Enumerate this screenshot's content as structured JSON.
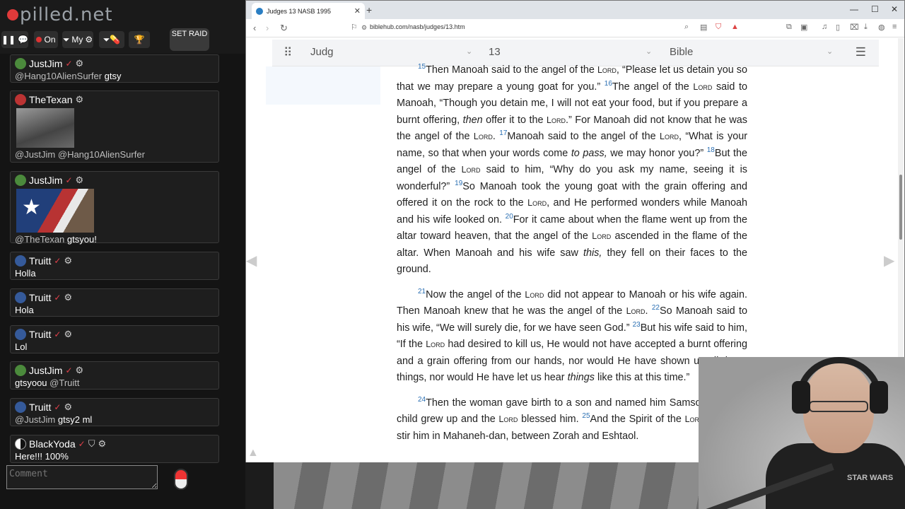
{
  "chat": {
    "logo": "pilled.net",
    "toolbar": {
      "on_label": "On",
      "my_label": "My",
      "raid_label": "SET RAID"
    },
    "messages": [
      {
        "user": "JustJim",
        "text": "",
        "mention": "@Hang10AlienSurfer",
        "tail": "gtsy",
        "avatar": "green"
      },
      {
        "user": "TheTexan",
        "text": "",
        "mention": "@JustJim @Hang10AlienSurfer",
        "tail": "",
        "avatar": "red",
        "image": "gif"
      },
      {
        "user": "JustJim",
        "text": "",
        "mention": "@TheTexan",
        "tail": "gtsyou!",
        "avatar": "green",
        "image": "texas"
      },
      {
        "user": "Truitt",
        "text": "Holla",
        "avatar": "blue"
      },
      {
        "user": "Truitt",
        "text": "Hola",
        "avatar": "blue"
      },
      {
        "user": "Truitt",
        "text": "Lol",
        "avatar": "blue"
      },
      {
        "user": "JustJim",
        "text": "gtsyoou",
        "mention": "@Truitt",
        "tail": "",
        "avatar": "green"
      },
      {
        "user": "Truitt",
        "text": "",
        "mention": "@JustJim",
        "tail": "gtsy2 ml",
        "avatar": "blue"
      },
      {
        "user": "BlackYoda",
        "text": "Here!!! 100%",
        "avatar": "yin"
      }
    ],
    "comment_placeholder": "Comment"
  },
  "browser": {
    "tab_title": "Judges 13 NASB 1995",
    "url": "biblehub.com/nasb/judges/13.htm",
    "selectors": {
      "book": "Judg",
      "chapter": "13",
      "version": "Bible"
    }
  },
  "scripture": {
    "paragraphs": [
      [
        {
          "t": "v",
          "s": "15"
        },
        {
          "t": "n",
          "s": "Then Manoah said to the angel of the "
        },
        {
          "t": "sc",
          "s": "Lord"
        },
        {
          "t": "n",
          "s": ", “Please let us detain you so that we may prepare a young goat for you.” "
        },
        {
          "t": "v",
          "s": "16"
        },
        {
          "t": "n",
          "s": "The angel of the "
        },
        {
          "t": "sc",
          "s": "Lord"
        },
        {
          "t": "n",
          "s": " said to Manoah, “Though you detain me, I will not eat your food, but if you prepare a burnt offering, "
        },
        {
          "t": "i",
          "s": "then"
        },
        {
          "t": "n",
          "s": " offer it to the "
        },
        {
          "t": "sc",
          "s": "Lord"
        },
        {
          "t": "n",
          "s": ".” For Manoah did not know that he was the angel of the "
        },
        {
          "t": "sc",
          "s": "Lord"
        },
        {
          "t": "n",
          "s": ". "
        },
        {
          "t": "v",
          "s": "17"
        },
        {
          "t": "n",
          "s": "Manoah said to the angel of the "
        },
        {
          "t": "sc",
          "s": "Lord"
        },
        {
          "t": "n",
          "s": ", “What is your name, so that when your words come "
        },
        {
          "t": "i",
          "s": "to pass,"
        },
        {
          "t": "n",
          "s": " we may honor you?” "
        },
        {
          "t": "v",
          "s": "18"
        },
        {
          "t": "n",
          "s": "But the angel of the "
        },
        {
          "t": "sc",
          "s": "Lord"
        },
        {
          "t": "n",
          "s": " said to him, “Why do you ask my name, seeing it is wonderful?” "
        },
        {
          "t": "v",
          "s": "19"
        },
        {
          "t": "n",
          "s": "So Manoah took the young goat with the grain offering and offered it on the rock to the "
        },
        {
          "t": "sc",
          "s": "Lord"
        },
        {
          "t": "n",
          "s": ", and He performed wonders while Manoah and his wife looked on. "
        },
        {
          "t": "v",
          "s": "20"
        },
        {
          "t": "n",
          "s": "For it came about when the flame went up from the altar toward heaven, that the angel of the "
        },
        {
          "t": "sc",
          "s": "Lord"
        },
        {
          "t": "n",
          "s": " ascended in the flame of the altar. When Manoah and his wife saw "
        },
        {
          "t": "i",
          "s": "this,"
        },
        {
          "t": "n",
          "s": " they fell on their faces to the ground."
        }
      ],
      [
        {
          "t": "v",
          "s": "21"
        },
        {
          "t": "n",
          "s": "Now the angel of the "
        },
        {
          "t": "sc",
          "s": "Lord"
        },
        {
          "t": "n",
          "s": " did not appear to Manoah or his wife again. Then Manoah knew that he was the angel of the "
        },
        {
          "t": "sc",
          "s": "Lord"
        },
        {
          "t": "n",
          "s": ". "
        },
        {
          "t": "v",
          "s": "22"
        },
        {
          "t": "n",
          "s": "So Manoah said to his wife, “We will surely die, for we have seen God.” "
        },
        {
          "t": "v",
          "s": "23"
        },
        {
          "t": "n",
          "s": "But his wife said to him, “If the "
        },
        {
          "t": "sc",
          "s": "Lord"
        },
        {
          "t": "n",
          "s": " had desired to kill us, He would not have accepted a burnt offering and a grain offering from our hands, nor would He have shown us all these things, nor would He have let us hear "
        },
        {
          "t": "i",
          "s": "things"
        },
        {
          "t": "n",
          "s": " like this at this time.”"
        }
      ],
      [
        {
          "t": "v",
          "s": "24"
        },
        {
          "t": "n",
          "s": "Then the woman gave birth to a son and named him Samson; and the child grew up and the "
        },
        {
          "t": "sc",
          "s": "Lord"
        },
        {
          "t": "n",
          "s": " blessed him. "
        },
        {
          "t": "v",
          "s": "25"
        },
        {
          "t": "n",
          "s": "And the Spirit of the "
        },
        {
          "t": "sc",
          "s": "Lord"
        },
        {
          "t": "n",
          "s": " began to stir him in Mahaneh-dan, between Zorah and Eshtaol."
        }
      ]
    ]
  },
  "webcam": {
    "shirt_print": "STAR WARS"
  },
  "colors": {
    "verse_number": "#2a6fb3",
    "chat_bg": "#141414",
    "accent_red": "#e0404a"
  }
}
